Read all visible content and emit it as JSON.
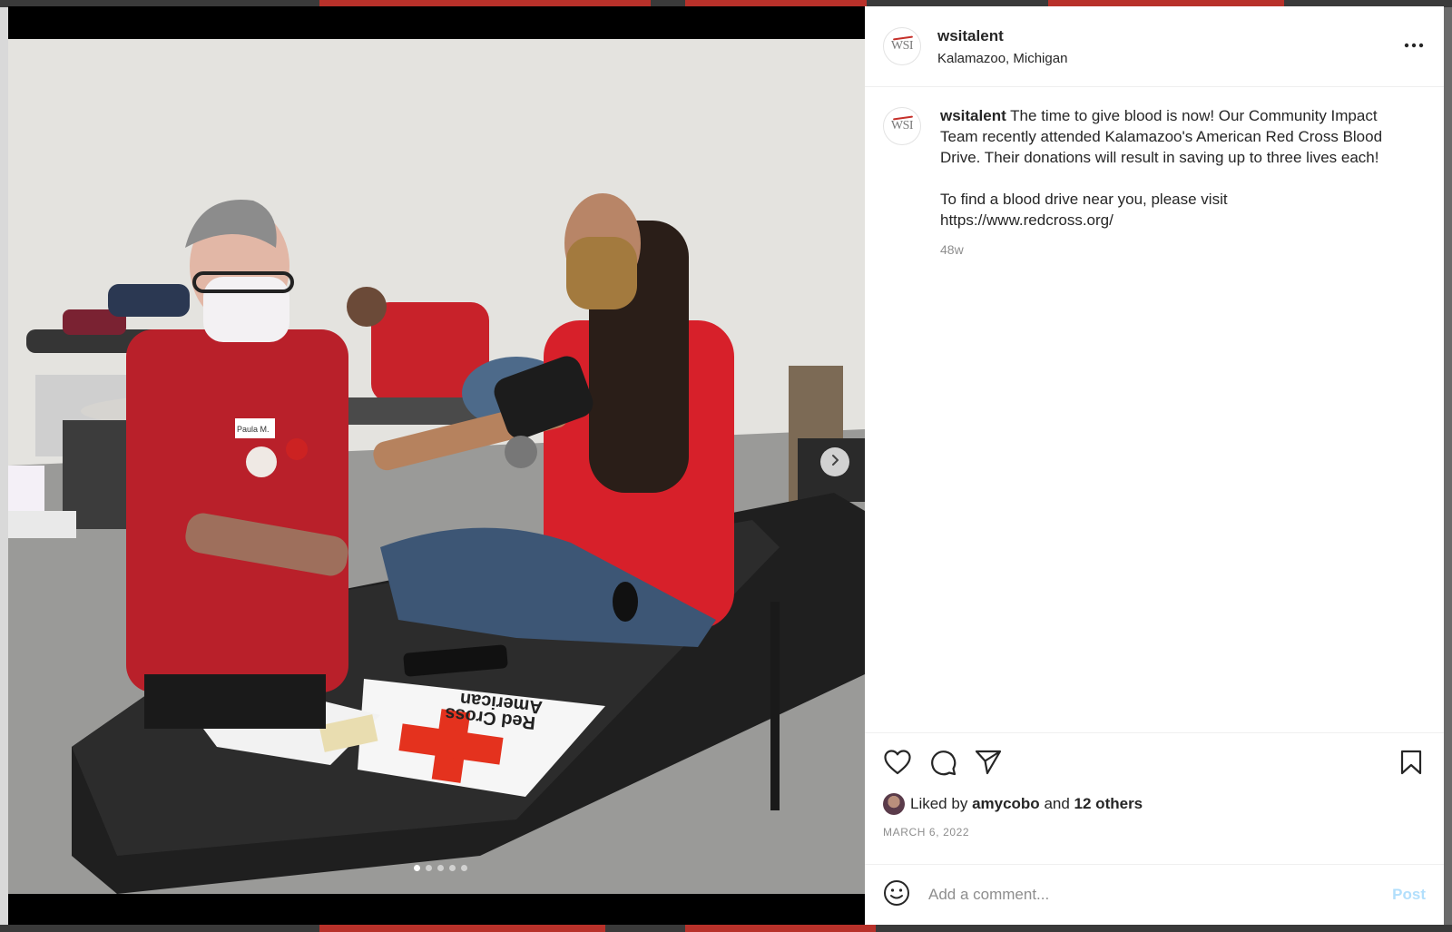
{
  "post": {
    "username": "wsitalent",
    "location": "Kalamazoo, Michigan",
    "avatar_text": "WSI",
    "caption_line1": "The time to give blood is now! Our Community Impact Team recently attended Kalamazoo's American Red Cross Blood Drive. Their donations will result in saving up to three lives each!",
    "caption_line2": "To find a blood drive near you, please visit https://www.redcross.org/",
    "time_ago": "48w",
    "liked_by_prefix": "Liked by",
    "liked_by_user": "amycobo",
    "liked_by_and": "and",
    "liked_by_others": "12 others",
    "date": "March 6, 2022"
  },
  "media": {
    "slide_count": 5,
    "active_slide": 1,
    "sign_text_line1": "American",
    "sign_text_line2": "Red Cross",
    "name_tag": "Paula M."
  },
  "comment": {
    "placeholder": "Add a comment...",
    "post_label": "Post"
  },
  "colors": {
    "accent": "#0095f6",
    "post_disabled": "#b2dffc",
    "red_cross": "#e4321e",
    "scrubs_red": "#c01f25"
  },
  "icons": [
    "more-icon",
    "heart-icon",
    "comment-icon",
    "share-icon",
    "bookmark-icon",
    "emoji-icon",
    "chevron-right-icon"
  ]
}
